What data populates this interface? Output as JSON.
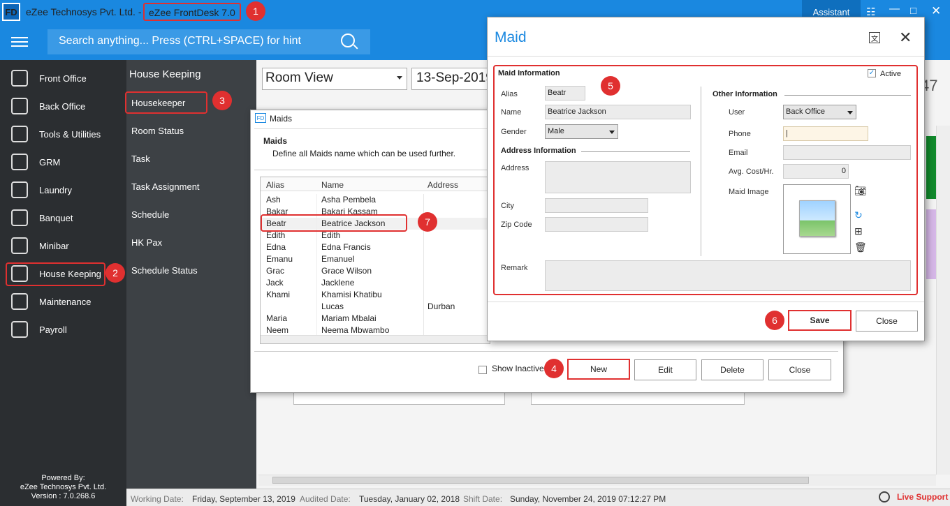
{
  "app": {
    "logo": "FD",
    "company": "eZee Technosys Pvt. Ltd. -",
    "product": "eZee FrontDesk 7.0",
    "assistant_label": "Assistant"
  },
  "search": {
    "placeholder": "Search anything... Press (CTRL+SPACE) for hint"
  },
  "left_nav": {
    "items": [
      {
        "label": "Front Office",
        "icon": "bell-icon"
      },
      {
        "label": "Back Office",
        "icon": "building-icon"
      },
      {
        "label": "Tools & Utilities",
        "icon": "tools-icon"
      },
      {
        "label": "GRM",
        "icon": "grm-icon"
      },
      {
        "label": "Laundry",
        "icon": "iron-icon"
      },
      {
        "label": "Banquet",
        "icon": "cutlery-icon"
      },
      {
        "label": "Minibar",
        "icon": "minibar-icon"
      },
      {
        "label": "House Keeping",
        "icon": "broom-icon"
      },
      {
        "label": "Maintenance",
        "icon": "maintenance-icon"
      },
      {
        "label": "Payroll",
        "icon": "payroll-icon"
      }
    ],
    "powered_by": [
      "Powered By:",
      "eZee Technosys Pvt. Ltd.",
      "Version : 7.0.268.6"
    ]
  },
  "sub_nav": {
    "title": "House Keeping",
    "items": [
      "Housekeeper",
      "Room Status",
      "Task",
      "Task Assignment",
      "Schedule",
      "HK Pax",
      "Schedule Status"
    ]
  },
  "main": {
    "view_select": "Room View",
    "date": "13-Sep-2019",
    "partial_number": "47"
  },
  "status_bar": {
    "working_label": "Working Date:",
    "working_value": "Friday, September 13, 2019",
    "audited_label": "Audited Date:",
    "audited_value": "Tuesday, January 02, 2018",
    "shift_label": "Shift Date:",
    "shift_value": "Sunday, November 24, 2019 07:12:27 PM",
    "live_support": "Live Support"
  },
  "maids_window": {
    "title_icon": "FD",
    "title": "Maids",
    "heading": "Maids",
    "description": "Define all Maids name which can be used further.",
    "columns": [
      "Alias",
      "Name",
      "Address"
    ],
    "rows": [
      {
        "alias": "Ash",
        "name": "Asha Pembela",
        "address": ""
      },
      {
        "alias": "Bakar",
        "name": "Bakari Kassam",
        "address": ""
      },
      {
        "alias": "Beatr",
        "name": "Beatrice Jackson",
        "address": ""
      },
      {
        "alias": "Edith",
        "name": "Edith",
        "address": ""
      },
      {
        "alias": "Edna",
        "name": "Edna Francis",
        "address": ""
      },
      {
        "alias": "Emanu",
        "name": "Emanuel",
        "address": ""
      },
      {
        "alias": "Grac",
        "name": "Grace Wilson",
        "address": ""
      },
      {
        "alias": "Jack",
        "name": "Jacklene",
        "address": ""
      },
      {
        "alias": "Khami",
        "name": "Khamisi Khatibu",
        "address": ""
      },
      {
        "alias": "",
        "name": "Lucas",
        "address": "Durban"
      },
      {
        "alias": "Maria",
        "name": "Mariam Mbalai",
        "address": ""
      },
      {
        "alias": "Neem",
        "name": "Neema Mbwambo",
        "address": ""
      }
    ],
    "show_inactive": "Show Inactive",
    "buttons": {
      "new": "New",
      "edit": "Edit",
      "delete": "Delete",
      "close": "Close"
    }
  },
  "maid_dialog": {
    "title": "Maid",
    "section_title": "Maid Information",
    "active_label": "Active",
    "alias_label": "Alias",
    "alias_value": "Beatr",
    "name_label": "Name",
    "name_value": "Beatrice Jackson",
    "gender_label": "Gender",
    "gender_value": "Male",
    "address_info": "Address Information",
    "address_label": "Address",
    "city_label": "City",
    "zip_label": "Zip Code",
    "remark_label": "Remark",
    "other_info": "Other Information",
    "user_label": "User",
    "user_value": "Back Office",
    "phone_label": "Phone",
    "email_label": "Email",
    "cost_label": "Avg. Cost/Hr.",
    "cost_value": "0",
    "image_label": "Maid Image",
    "save": "Save",
    "close": "Close"
  },
  "markers": [
    "1",
    "2",
    "3",
    "4",
    "5",
    "6",
    "7"
  ],
  "colors": {
    "accent": "#1a88e0",
    "highlight": "#e03030",
    "nav_bg": "#2b2e31"
  }
}
